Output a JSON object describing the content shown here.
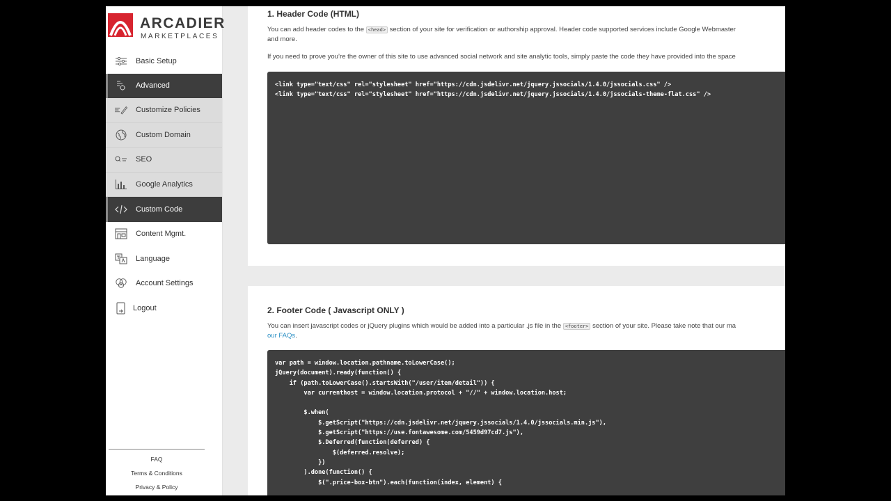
{
  "brand": {
    "name": "ARCADIER",
    "tagline": "MARKETPLACES",
    "color": "#d7242f"
  },
  "sidebar": {
    "items": [
      {
        "label": "Basic Setup",
        "icon": "sliders-icon",
        "state": "plain"
      },
      {
        "label": "Advanced",
        "icon": "advanced-settings-icon",
        "state": "active"
      },
      {
        "label": "Customize Policies",
        "icon": "pen-lines-icon",
        "state": "grey"
      },
      {
        "label": "Custom Domain",
        "icon": "globe-icon",
        "state": "grey"
      },
      {
        "label": "SEO",
        "icon": "seo-search-icon",
        "state": "grey"
      },
      {
        "label": "Google Analytics",
        "icon": "bar-chart-icon",
        "state": "grey"
      },
      {
        "label": "Custom Code",
        "icon": "code-brackets-icon",
        "state": "active"
      },
      {
        "label": "Content Mgmt.",
        "icon": "storefront-icon",
        "state": "plain"
      },
      {
        "label": "Language",
        "icon": "translate-icon",
        "state": "plain"
      },
      {
        "label": "Account Settings",
        "icon": "users-icon",
        "state": "plain"
      },
      {
        "label": "Logout",
        "icon": "logout-icon",
        "state": "plain"
      }
    ],
    "footer": {
      "faq": "FAQ",
      "terms": "Terms & Conditions",
      "privacy": "Privacy & Policy"
    }
  },
  "header_section": {
    "title": "1. Header Code (HTML)",
    "desc_before": "You can add header codes to the ",
    "desc_tag": "<head>",
    "desc_after": " section of your site for verification or authorship approval. Header code supported services include Google Webmaster",
    "desc_line2": "and more.",
    "desc2": "If you need to prove you’re the owner of this site to use advanced social network and site analytic tools, simply paste the code they have provided into the space",
    "code": "<link type=\"text/css\" rel=\"stylesheet\" href=\"https://cdn.jsdelivr.net/jquery.jssocials/1.4.0/jssocials.css\" />\n<link type=\"text/css\" rel=\"stylesheet\" href=\"https://cdn.jsdelivr.net/jquery.jssocials/1.4.0/jssocials-theme-flat.css\" />"
  },
  "footer_section": {
    "title": "2. Footer Code ( Javascript ONLY )",
    "desc_before": "You can insert javascript codes or jQuery plugins which would be added into a particular .js file in the ",
    "desc_tag": "<footer>",
    "desc_after": " section of your site. Please take note that our ma",
    "desc_link": "our FAQs",
    "desc_link_end": ".",
    "code": "var path = window.location.pathname.toLowerCase();\njQuery(document).ready(function() {\n    if (path.toLowerCase().startsWith(\"/user/item/detail\")) {\n        var currenthost = window.location.protocol + \"//\" + window.location.host;\n\n        $.when(\n            $.getScript(\"https://cdn.jsdelivr.net/jquery.jssocials/1.4.0/jssocials.min.js\"),\n            $.getScript(\"https://use.fontawesome.com/5459d97cd7.js\"),\n            $.Deferred(function(deferred) {\n                $(deferred.resolve);\n            })\n        ).done(function() {\n            $(\".price-box-btn\").each(function(index, element) {"
  }
}
